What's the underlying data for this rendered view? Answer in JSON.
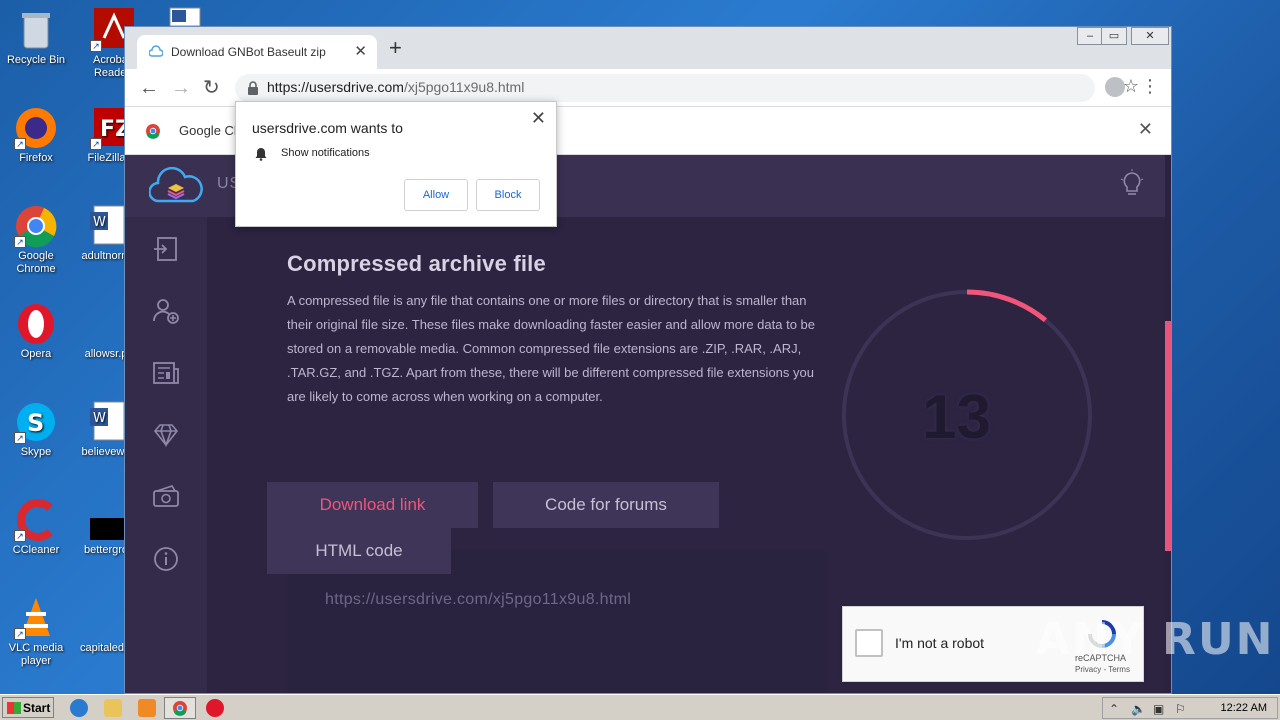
{
  "desktop": {
    "icons": [
      {
        "label": "Recycle Bin",
        "icon": "recycle-bin-icon"
      },
      {
        "label": "Acrobat Reader",
        "icon": "acrobat-icon"
      },
      {
        "label": "Firefox",
        "icon": "firefox-icon"
      },
      {
        "label": "FileZilla C",
        "icon": "filezilla-icon"
      },
      {
        "label": "Google Chrome",
        "icon": "chrome-icon"
      },
      {
        "label": "adultnorm",
        "icon": "word-doc-icon"
      },
      {
        "label": "Opera",
        "icon": "opera-icon"
      },
      {
        "label": "allowsr.p",
        "icon": "file-icon"
      },
      {
        "label": "Skype",
        "icon": "skype-icon"
      },
      {
        "label": "believewe",
        "icon": "word-doc-icon"
      },
      {
        "label": "CCleaner",
        "icon": "ccleaner-icon"
      },
      {
        "label": "bettergro",
        "icon": "black-file-icon"
      },
      {
        "label": "VLC media player",
        "icon": "vlc-icon"
      },
      {
        "label": "capitaled",
        "icon": "file-icon"
      }
    ]
  },
  "browser": {
    "tab_title": "Download GNBot Baseult zip",
    "url_host": "https://usersdrive.com",
    "url_path": "/xj5pgo11x9u8.html",
    "infobar_text": "Google Ch"
  },
  "permission_popup": {
    "title": "usersdrive.com wants to",
    "permission": "Show notifications",
    "allow_label": "Allow",
    "block_label": "Block"
  },
  "site": {
    "logo_text": "US",
    "heading": "Compressed archive file",
    "description": "A compressed file is any file that contains one or more files or directory that is smaller than their original file size. These files make downloading faster easier and allow more data to be stored on a removable media. Common compressed file extensions are .ZIP, .RAR, .ARJ, .TAR.GZ, and .TGZ. Apart from these, there will be different compressed file extensions you are likely to come across when working on a computer.",
    "tabs": {
      "download_link": "Download link",
      "code_for_forums": "Code for forums",
      "html_code": "HTML code"
    },
    "link_url": "https://usersdrive.com/xj5pgo11x9u8.html",
    "countdown": "13",
    "countdown_progress_fraction": 0.11,
    "accent_color": "#f0557a"
  },
  "recaptcha": {
    "label": "I'm not a robot",
    "brand": "reCAPTCHA",
    "links": "Privacy - Terms"
  },
  "watermark": "ANY RUN",
  "taskbar": {
    "start_label": "Start",
    "clock": "12:22 AM"
  }
}
